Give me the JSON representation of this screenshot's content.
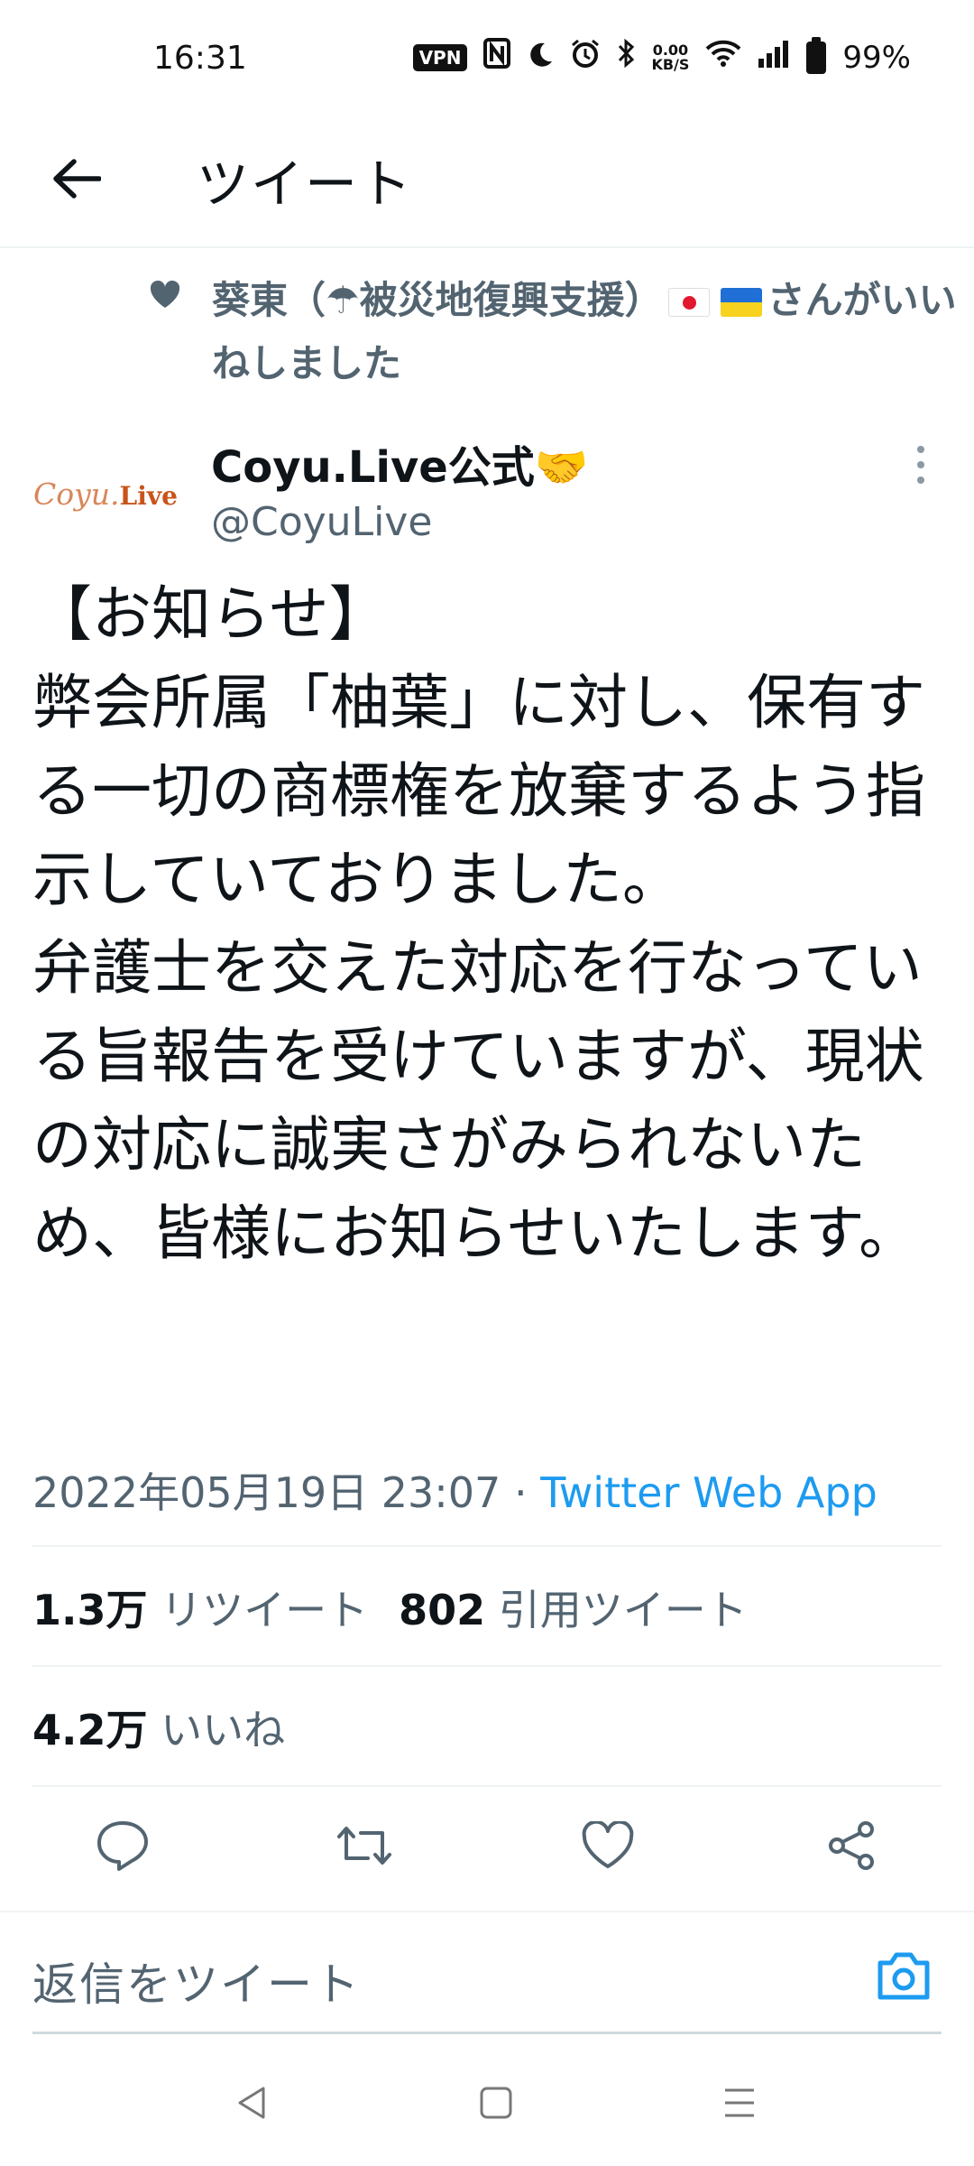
{
  "status_bar": {
    "time": "16:31",
    "vpn": "VPN",
    "net_speed_value": "0.00",
    "net_speed_unit": "KB/S",
    "battery": "99%"
  },
  "header": {
    "title": "ツイート"
  },
  "liked_notice": {
    "name": "葵東（☂被災地復興支援）",
    "suffix": "さんがいいねしました"
  },
  "author": {
    "avatar_text": "Coyu.",
    "avatar_text_2": "Live",
    "name": "Coyu.Live公式🤝",
    "handle": "@CoyuLive"
  },
  "tweet": {
    "text": "【お知らせ】\n弊会所属「柚葉」に対し、保有する一切の商標権を放棄するよう指示していておりました。\n弁護士を交えた対応を行なっている旨報告を受けていますが、現状の対応に誠実さがみられないため、皆様にお知らせいたします。",
    "date": "2022年05月19日 23:07",
    "separator": " · ",
    "source": "Twitter Web App"
  },
  "stats": {
    "retweets_count": "1.3万",
    "retweets_label": "リツイート",
    "quotes_count": "802",
    "quotes_label": "引用ツイート",
    "likes_count": "4.2万",
    "likes_label": "いいね"
  },
  "reply": {
    "placeholder": "返信をツイート"
  },
  "colors": {
    "accent": "#1d9bf0",
    "secondary_text": "#536471",
    "divider": "#eff3f4"
  }
}
